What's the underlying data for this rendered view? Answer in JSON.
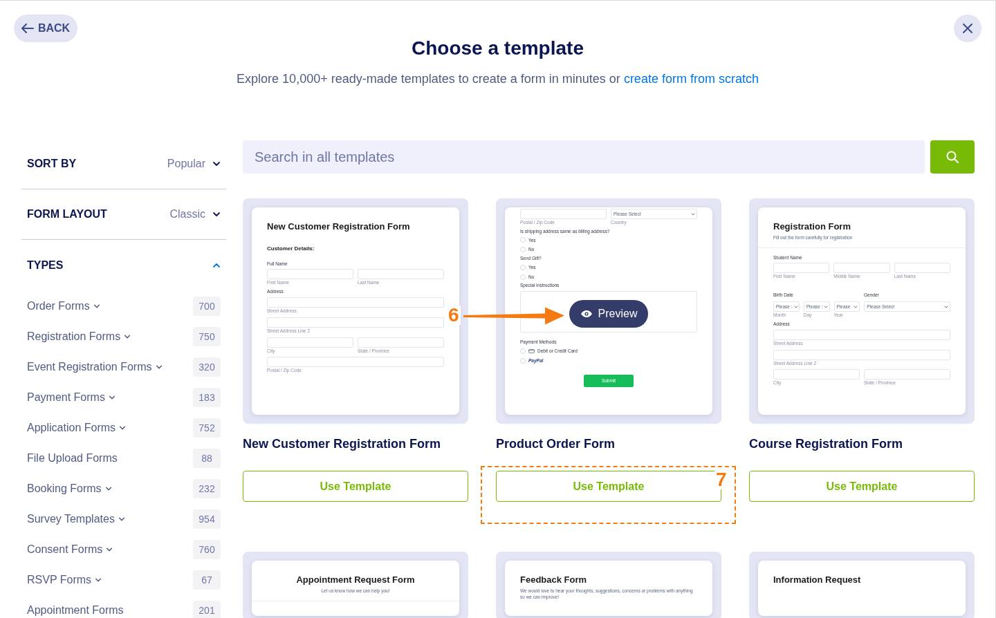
{
  "back_button": "BACK",
  "title": "Choose a template",
  "subtitle": {
    "text": "Explore 10,000+ ready-made templates to create a form in minutes or ",
    "link": "create form from scratch"
  },
  "sidebar": {
    "sort": {
      "label": "SORT BY",
      "value": "Popular"
    },
    "layout": {
      "label": "FORM LAYOUT",
      "value": "Classic"
    },
    "types": {
      "label": "TYPES",
      "expanded": true,
      "items": [
        {
          "name": "Order Forms",
          "has_submenu": true,
          "count": "700"
        },
        {
          "name": "Registration Forms",
          "has_submenu": true,
          "count": "750"
        },
        {
          "name": "Event Registration Forms",
          "has_submenu": true,
          "count": "320"
        },
        {
          "name": "Payment Forms",
          "has_submenu": true,
          "count": "183"
        },
        {
          "name": "Application Forms",
          "has_submenu": true,
          "count": "752"
        },
        {
          "name": "File Upload Forms",
          "has_submenu": false,
          "count": "88"
        },
        {
          "name": "Booking Forms",
          "has_submenu": true,
          "count": "232"
        },
        {
          "name": "Survey Templates",
          "has_submenu": true,
          "count": "954"
        },
        {
          "name": "Consent Forms",
          "has_submenu": true,
          "count": "760"
        },
        {
          "name": "RSVP Forms",
          "has_submenu": true,
          "count": "67"
        },
        {
          "name": "Appointment Forms",
          "has_submenu": false,
          "count": "201"
        }
      ]
    }
  },
  "search": {
    "placeholder": "Search in all templates"
  },
  "templates": [
    {
      "name": "New Customer Registration Form",
      "button": "Use Template",
      "preview": {
        "scrolled": false,
        "blocks": [
          {
            "kind": "title",
            "text": "New Customer Registration Form",
            "centered": false
          },
          {
            "kind": "section",
            "text": "Customer Details:"
          },
          {
            "kind": "label",
            "text": "Full Name"
          },
          {
            "kind": "fields",
            "items": [
              {
                "sub": "First Name"
              },
              {
                "sub": "Last Name"
              }
            ]
          },
          {
            "kind": "label",
            "text": "Address"
          },
          {
            "kind": "fields",
            "items": [
              {
                "sub": "Street Address"
              }
            ]
          },
          {
            "kind": "fields",
            "items": [
              {
                "sub": "Street Address Line 2"
              }
            ]
          },
          {
            "kind": "fields",
            "items": [
              {
                "sub": "City"
              },
              {
                "sub": "State / Province"
              }
            ]
          },
          {
            "kind": "fields",
            "items": [
              {
                "sub": "Postal / Zip Code"
              }
            ]
          }
        ]
      }
    },
    {
      "name": "Product Order Form",
      "button": "Use Template",
      "preview_button": "Preview",
      "preview": {
        "scrolled": true,
        "blocks": [
          {
            "kind": "fields",
            "items": [
              {
                "sub": "Postal / Zip Code"
              },
              {
                "select": "Please Select",
                "sub": "Country"
              }
            ]
          },
          {
            "kind": "label",
            "text": "Is shipping address same as billing address?"
          },
          {
            "kind": "radio",
            "text": "Yes",
            "checked": false
          },
          {
            "kind": "radio",
            "text": "No",
            "checked": false
          },
          {
            "kind": "label",
            "text": "Send Gift?"
          },
          {
            "kind": "radio",
            "text": "Yes",
            "checked": false
          },
          {
            "kind": "radio",
            "text": "No",
            "checked": false
          },
          {
            "kind": "label",
            "text": "Special Instructions"
          },
          {
            "kind": "textarea"
          },
          {
            "kind": "label",
            "text": "Payment Methods"
          },
          {
            "kind": "card_radio",
            "text": "Debit or Credit Card",
            "checked": false
          },
          {
            "kind": "paypal_radio",
            "text": "PayPal",
            "checked": false
          },
          {
            "kind": "button",
            "text": "Submit"
          }
        ]
      }
    },
    {
      "name": "Course Registration Form",
      "button": "Use Template",
      "preview": {
        "scrolled": false,
        "blocks": [
          {
            "kind": "title",
            "text": "Registration Form",
            "centered": false
          },
          {
            "kind": "subtitle",
            "text": "Fill out the form carefully for registration"
          },
          {
            "kind": "divider"
          },
          {
            "kind": "label",
            "text": "Student Name"
          },
          {
            "kind": "fields",
            "items": [
              {
                "sub": "First Name"
              },
              {
                "sub": "Middle Name"
              },
              {
                "sub": "Last Name"
              }
            ]
          },
          {
            "kind": "labels",
            "items": [
              "Birth Date",
              "Gender"
            ]
          },
          {
            "kind": "fields",
            "items": [
              {
                "select": "Please :",
                "sub": "Month"
              },
              {
                "select": "Please :",
                "sub": "Day"
              },
              {
                "select": "Please",
                "sub": "Year"
              },
              {
                "select": "Please Select",
                "wide": true
              }
            ]
          },
          {
            "kind": "label",
            "text": "Address"
          },
          {
            "kind": "fields",
            "items": [
              {
                "sub": "Street Address"
              }
            ]
          },
          {
            "kind": "fields",
            "items": [
              {
                "sub": "Street Address Line 2"
              }
            ]
          },
          {
            "kind": "fields",
            "items": [
              {
                "sub": "City"
              },
              {
                "sub": "State / Province"
              }
            ]
          }
        ]
      }
    },
    {
      "preview": {
        "scrolled": false,
        "blocks": [
          {
            "kind": "title",
            "text": "Appointment Request Form",
            "centered": true
          },
          {
            "kind": "subtitle",
            "text": "Let us know how we can help you!"
          },
          {
            "kind": "divider"
          }
        ]
      }
    },
    {
      "preview": {
        "scrolled": false,
        "blocks": [
          {
            "kind": "title",
            "text": "Feedback Form",
            "centered": false
          },
          {
            "kind": "subtitle",
            "text": "We would love to hear your thoughts, suggestions, concerns or problems with anything so we can improve!"
          }
        ]
      }
    },
    {
      "preview": {
        "scrolled": false,
        "blocks": [
          {
            "kind": "title",
            "text": "Information Request",
            "centered": false
          }
        ]
      }
    }
  ],
  "annotations": [
    {
      "kind": "arrow",
      "label": "6"
    },
    {
      "kind": "box",
      "label": "7"
    }
  ]
}
